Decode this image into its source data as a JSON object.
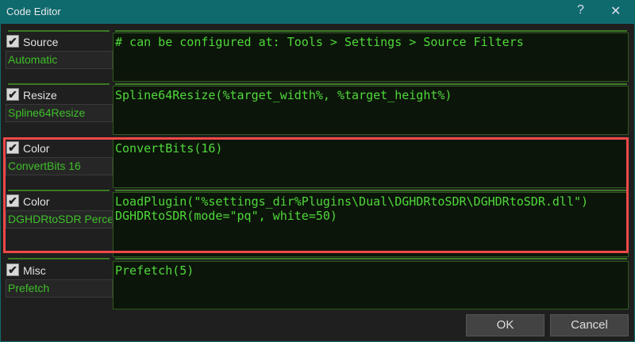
{
  "window": {
    "title": "Code Editor",
    "help": "?",
    "close": "✕"
  },
  "sections": [
    {
      "category": "Source",
      "checked": true,
      "filter": "Automatic",
      "code": "# can be configured at: Tools > Settings > Source Filters"
    },
    {
      "category": "Resize",
      "checked": true,
      "filter": "Spline64Resize",
      "code": "Spline64Resize(%target_width%, %target_height%)"
    },
    {
      "category": "Color",
      "checked": true,
      "filter": "ConvertBits 16",
      "code": "ConvertBits(16)"
    },
    {
      "category": "Color",
      "checked": true,
      "filter": "DGHDRtoSDR Perceptual",
      "code": "LoadPlugin(\"%settings_dir%Plugins\\Dual\\DGHDRtoSDR\\DGHDRtoSDR.dll\")\nDGHDRtoSDR(mode=\"pq\", white=50)"
    },
    {
      "category": "Misc",
      "checked": true,
      "filter": "Prefetch",
      "code": "Prefetch(5)"
    }
  ],
  "check_glyph": "✔",
  "buttons": {
    "ok": "OK",
    "cancel": "Cancel"
  }
}
